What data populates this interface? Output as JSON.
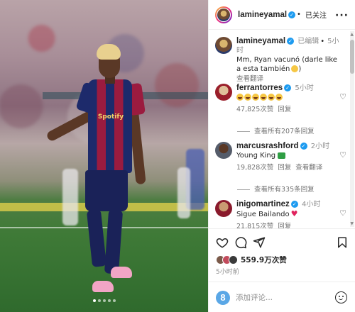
{
  "header": {
    "username": "lamineyamal",
    "follow_state": "已关注"
  },
  "caption": {
    "username": "lamineyamal",
    "edited": "已编辑",
    "time": "5小时",
    "text": "Mm, Ryan vacunó (darle like a esta también",
    "text_end": ")",
    "translate": "查看翻译"
  },
  "comments": [
    {
      "username": "ferrantorres",
      "time": "5小时",
      "emoji_count": 6,
      "likes": "47,825次赞",
      "reply": "回复",
      "view_replies": "查看所有207条回复"
    },
    {
      "username": "marcusrashford",
      "time": "2小时",
      "text": "Young King",
      "likes": "19,828次赞",
      "reply": "回复",
      "translate": "查看翻译",
      "view_replies": "查看所有335条回复"
    },
    {
      "username": "inigomartinez",
      "time": "4小时",
      "text": "Sigue Bailando",
      "likes": "21,815次赞",
      "reply": "回复"
    }
  ],
  "actions": {
    "likes": "559.9万次赞",
    "posted": "5小时前"
  },
  "composer": {
    "brand": "8",
    "placeholder": "添加评论..."
  },
  "photo": {
    "sponsor": "Spotify",
    "slide_count": 5,
    "active_slide": 0
  },
  "colors": {
    "verified": "#1d9bf0",
    "like_heart": "#e0245e",
    "jersey_blue": "#1d2a6b",
    "jersey_red": "#9b1b3f"
  },
  "icons": [
    "heart-icon",
    "comment-icon",
    "share-icon",
    "bookmark-icon",
    "more-icon",
    "verified-icon",
    "emoji-icon"
  ]
}
